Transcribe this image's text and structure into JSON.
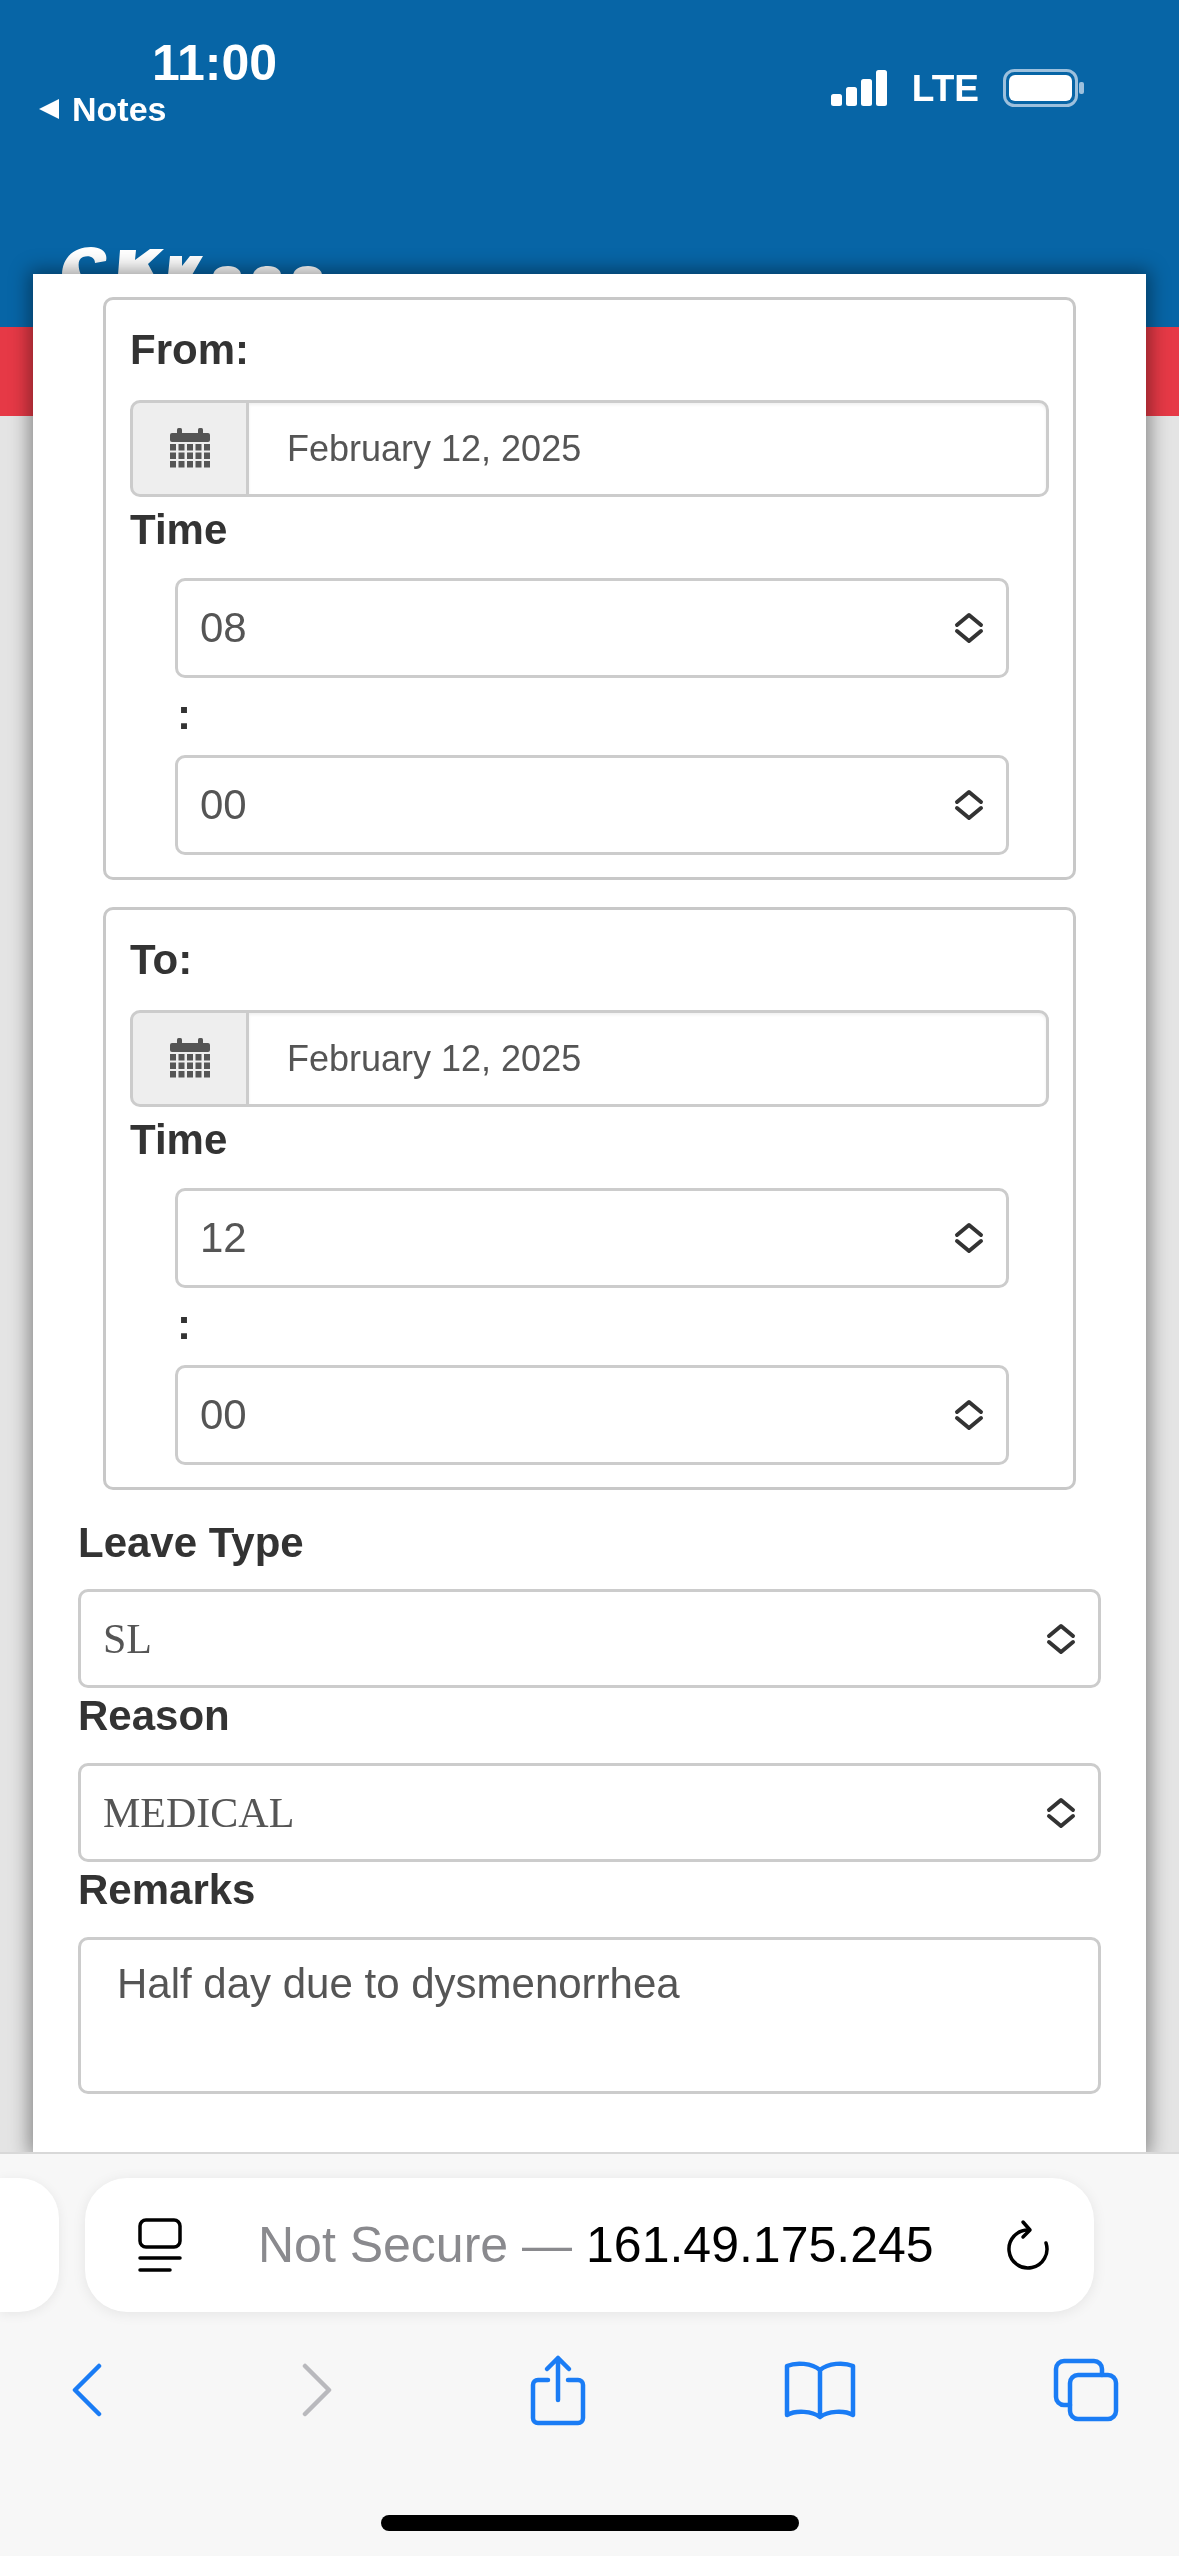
{
  "status_bar": {
    "time": "11:00",
    "back_label": "Notes",
    "network": "LTE"
  },
  "form": {
    "periods": [
      {
        "legend": "From:",
        "date": "February 12, 2025",
        "time_label": "Time",
        "hour": "08",
        "separator": ":",
        "minute": "00"
      },
      {
        "legend": "To:",
        "date": "February 12, 2025",
        "time_label": "Time",
        "hour": "12",
        "separator": ":",
        "minute": "00"
      }
    ],
    "fields": [
      {
        "kind": "select",
        "label": "Leave Type",
        "value": "SL"
      },
      {
        "kind": "select",
        "label": "Reason",
        "value": "MEDICAL"
      },
      {
        "kind": "textarea",
        "label": "Remarks",
        "value": "Half day due to dysmenorrhea"
      }
    ]
  },
  "browser": {
    "security_note": "Not Secure —",
    "address": "161.49.175.245",
    "nav": [
      {
        "kind": "back",
        "disabled": false
      },
      {
        "kind": "forward",
        "disabled": true
      },
      {
        "kind": "share",
        "disabled": false
      },
      {
        "kind": "bookmarks",
        "disabled": false
      },
      {
        "kind": "tabs",
        "disabled": false
      }
    ]
  }
}
